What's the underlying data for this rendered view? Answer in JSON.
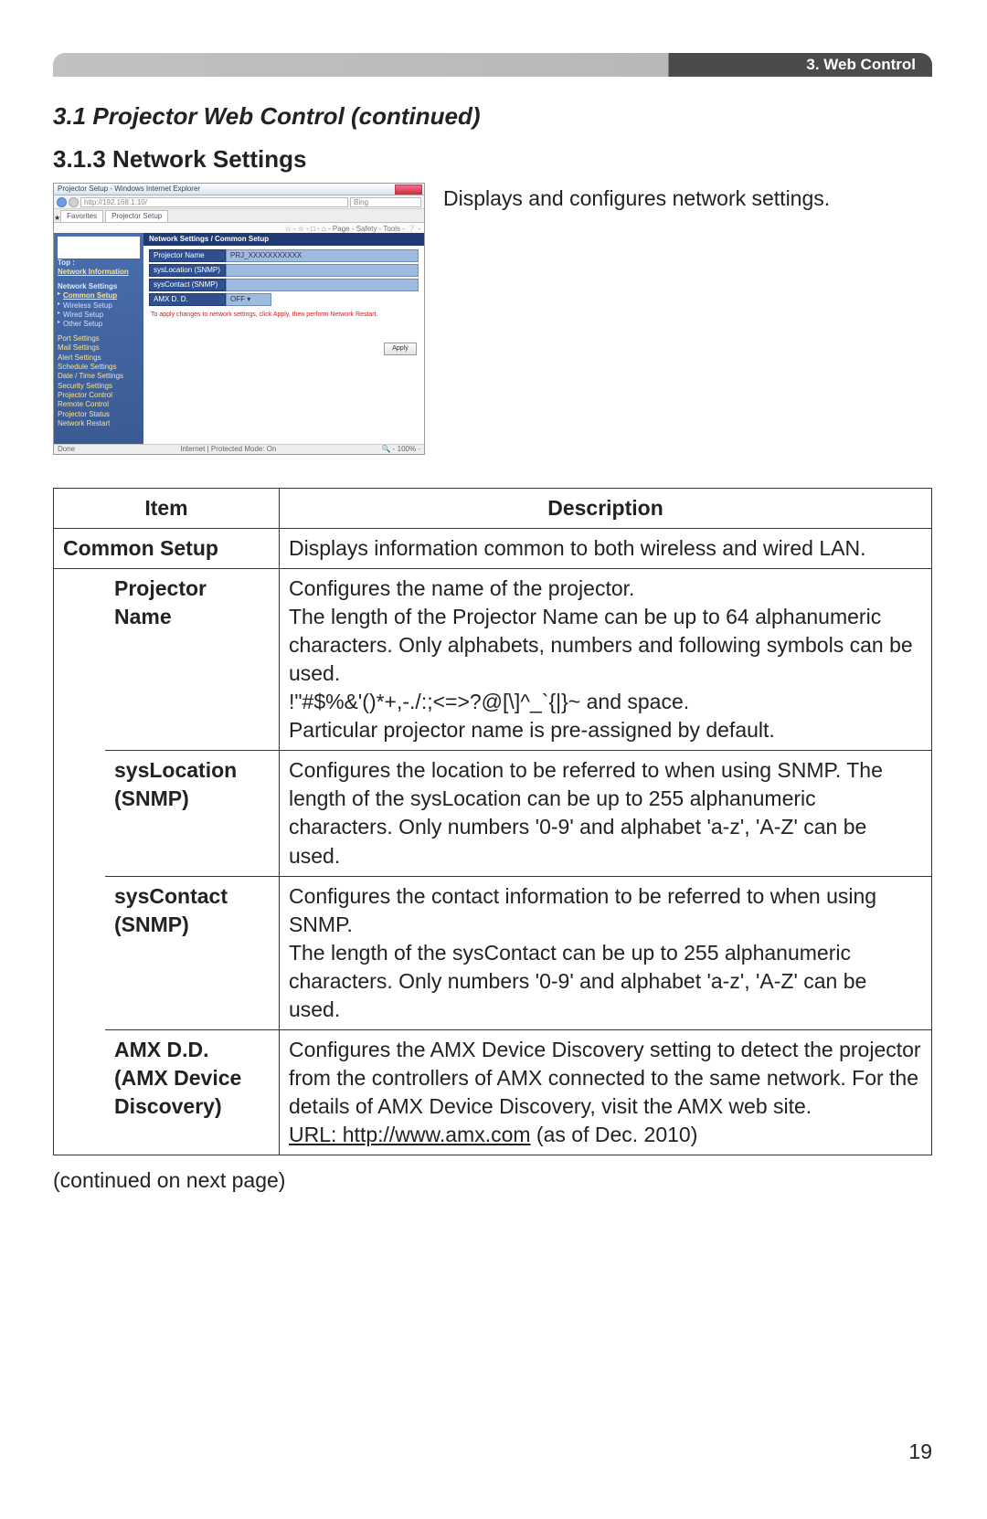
{
  "header": {
    "chapter": "3. Web Control"
  },
  "section": {
    "title": "3.1 Projector Web Control (continued)",
    "subsection": "3.1.3 Network Settings",
    "intro": "Displays and configures network settings."
  },
  "screenshot": {
    "browser_titlebar": "Projector Setup - Windows Internet Explorer",
    "url_hint": "http://192.168.1.10/",
    "search_hint": "Bing",
    "ie_menu": "☆ - ☆ - □ - ⌂ - Page - Safety - Tools - ❔ -",
    "tabs": [
      "Favorites",
      "Projector Setup"
    ],
    "panel_title": "Network Settings / Common Setup",
    "sidebar": {
      "top_heading": "Top :",
      "top_item": "Network Information",
      "net_heading": "Network Settings",
      "net_items": [
        "Common Setup",
        "Wireless Setup",
        "Wired Setup",
        "Other Setup"
      ],
      "other_items": [
        "Port Settings",
        "Mail Settings",
        "Alert Settings",
        "Schedule Settings",
        "Date / Time Settings",
        "Security Settings",
        "Projector Control",
        "Remote Control",
        "Projector Status",
        "Network Restart"
      ]
    },
    "form": {
      "rows": [
        {
          "label": "Projector Name",
          "value": "PRJ_XXXXXXXXXXX"
        },
        {
          "label": "sysLocation (SNMP)",
          "value": ""
        },
        {
          "label": "sysContact (SNMP)",
          "value": ""
        },
        {
          "label": "AMX D. D.",
          "value": "OFF ▾"
        }
      ],
      "note": "To apply changes to network settings, click Apply, then perform Network Restart.",
      "apply_label": "Apply"
    },
    "status_left": "Done",
    "status_center": "Internet | Protected Mode: On",
    "status_right": "🔍 - 100% -"
  },
  "table": {
    "header_item": "Item",
    "header_desc": "Description",
    "rows": {
      "common_setup": {
        "item": "Common Setup",
        "desc": "Displays information common to both wireless and wired LAN."
      },
      "projector_name": {
        "item": "Projector Name",
        "desc": "Configures the name of the projector.\nThe length of the Projector Name can be up to 64 alphanumeric characters. Only alphabets, numbers and following symbols can be used.\n !\"#$%&'()*+,-./:;<=>?@[\\]^_`{|}~ and space.\nParticular projector name is pre-assigned by default."
      },
      "sys_location": {
        "item": "sysLocation (SNMP)",
        "desc": "Configures the location to be referred to when using SNMP. The length of the sysLocation can be up to 255 alphanumeric characters. Only numbers '0-9' and alphabet 'a-z', 'A-Z' can be used."
      },
      "sys_contact": {
        "item": "sysContact (SNMP)",
        "desc": "Configures the contact information to be referred to when using SNMP.\nThe length of the sysContact can be up to 255 alphanumeric characters. Only numbers '0-9' and alphabet 'a-z', 'A-Z' can be used."
      },
      "amx_dd": {
        "item": "AMX D.D.\n(AMX Device Discovery)",
        "desc_pre": "Configures the AMX Device Discovery setting to detect the projector from the controllers of AMX connected to the same network. For the details of AMX Device Discovery, visit the AMX web site.",
        "url_label": "URL: http://www.amx.com",
        "desc_post": " (as of Dec. 2010)"
      }
    }
  },
  "footer": {
    "continued": "(continued on next page)",
    "page_number": "19"
  }
}
